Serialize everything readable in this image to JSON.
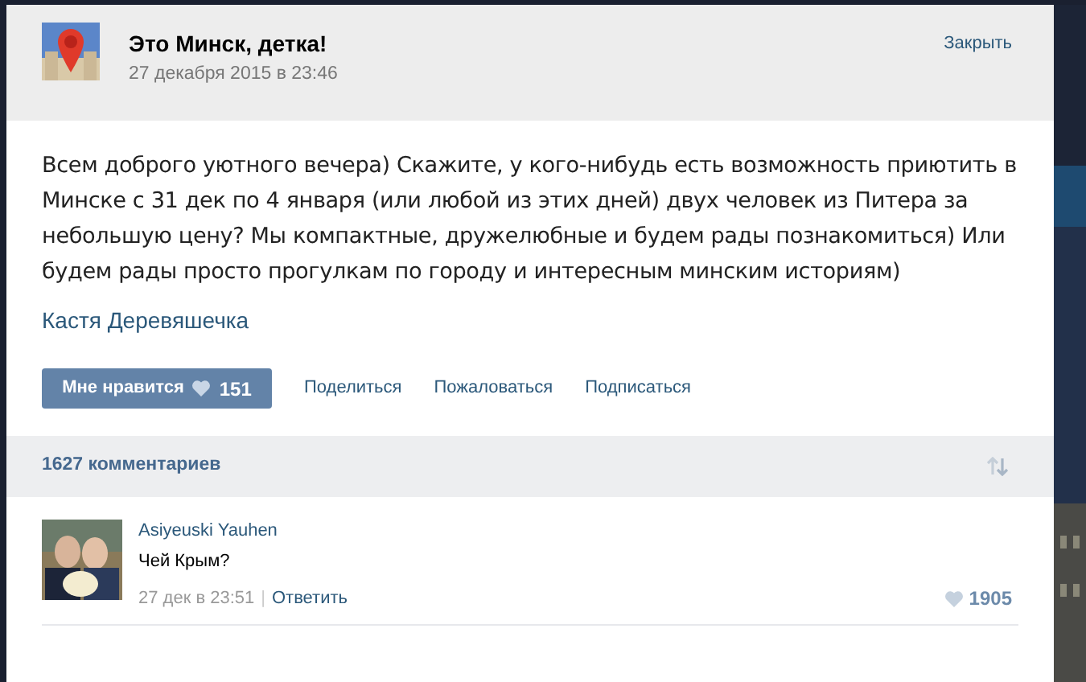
{
  "post": {
    "group_name": "Это Минск, детка!",
    "date": "27 декабря 2015 в 23:46",
    "close": "Закрыть",
    "text": "Всем доброго уютного вечера) Скажите, у кого-нибудь есть возможность приютить в Минске с 31 дек по 4 января (или любой из этих дней) двух человек из Питера за небольшую цену? Мы компактные, дружелюбные и будем рады познакомиться) Или будем рады просто прогулкам по городу и интересным минским историям)",
    "author": "Кастя Деревяшечка",
    "like": {
      "label": "Мне нравится",
      "count": "151"
    },
    "actions": [
      "Поделиться",
      "Пожаловаться",
      "Подписаться"
    ]
  },
  "comments": {
    "count": "1627 комментариев",
    "items": [
      {
        "name": "Asiyeuski Yauhen",
        "text": "Чей Крым?",
        "date": "27 дек в 23:51",
        "separator": "|",
        "reply": "Ответить",
        "likes": "1905"
      }
    ]
  }
}
